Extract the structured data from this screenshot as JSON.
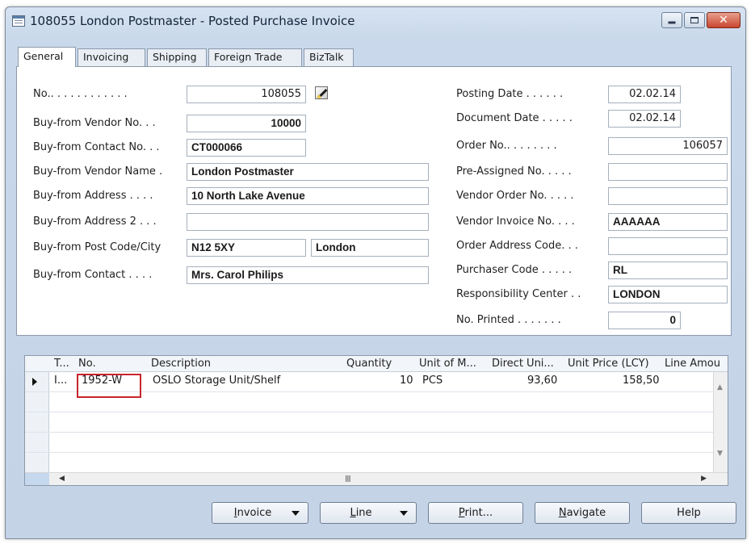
{
  "window": {
    "title": "108055 London Postmaster - Posted Purchase Invoice",
    "close_glyph": "✕"
  },
  "tabs": [
    "General",
    "Invoicing",
    "Shipping",
    "Foreign Trade",
    "BizTalk"
  ],
  "general": {
    "left": [
      {
        "label": "No.. . . . . . . . . . . .",
        "value": "108055"
      },
      {
        "label": "Buy-from Vendor No. . .",
        "value": "10000"
      },
      {
        "label": "Buy-from Contact No. . .",
        "value": "CT000066"
      },
      {
        "label": "Buy-from Vendor Name .",
        "value": "London Postmaster"
      },
      {
        "label": "Buy-from Address . . . .",
        "value": "10 North Lake Avenue"
      },
      {
        "label": "Buy-from Address 2 . . .",
        "value": ""
      },
      {
        "label": "Buy-from Post Code/City",
        "value": "N12 5XY",
        "value2": "London"
      },
      {
        "label": "Buy-from Contact . . . .",
        "value": "Mrs. Carol Philips"
      }
    ],
    "right": [
      {
        "label": "Posting Date . . . . . .",
        "value": "02.02.14"
      },
      {
        "label": "Document Date . . . . .",
        "value": "02.02.14"
      },
      {
        "label": "Order No.. . . . . . . .",
        "value": "106057"
      },
      {
        "label": "Pre-Assigned No. . . . .",
        "value": ""
      },
      {
        "label": "Vendor Order No. . . . .",
        "value": ""
      },
      {
        "label": "Vendor Invoice No. . . .",
        "value": "AAAAAA"
      },
      {
        "label": "Order Address Code. . .",
        "value": ""
      },
      {
        "label": "Purchaser Code . . . . .",
        "value": "RL"
      },
      {
        "label": "Responsibility Center . .",
        "value": "LONDON"
      },
      {
        "label": "No. Printed . . . . . . .",
        "value": "0"
      }
    ]
  },
  "lines": {
    "headers": [
      "T...",
      "No.",
      "Description",
      "Quantity",
      "Unit of M...",
      "Direct Uni...",
      "Unit Price (LCY)",
      "Line Amou"
    ],
    "rows": [
      [
        "I...",
        "1952-W",
        "OSLO Storage Unit/Shelf",
        "10",
        "PCS",
        "93,60",
        "158,50",
        ""
      ]
    ],
    "hscroll_grip": "III"
  },
  "buttons": [
    {
      "pre": "",
      "ul": "I",
      "post": "nvoice",
      "dropdown": true
    },
    {
      "pre": "",
      "ul": "L",
      "post": "ine",
      "dropdown": true
    },
    {
      "pre": "",
      "ul": "P",
      "post": "rint...",
      "dropdown": false
    },
    {
      "pre": "",
      "ul": "N",
      "post": "avigate",
      "dropdown": false
    },
    {
      "pre": "Help",
      "ul": "",
      "post": "",
      "dropdown": false
    }
  ],
  "colors": {
    "highlight": "#c8242c",
    "title_bg": "#c9d8ea",
    "close_button": "#c8452e"
  }
}
